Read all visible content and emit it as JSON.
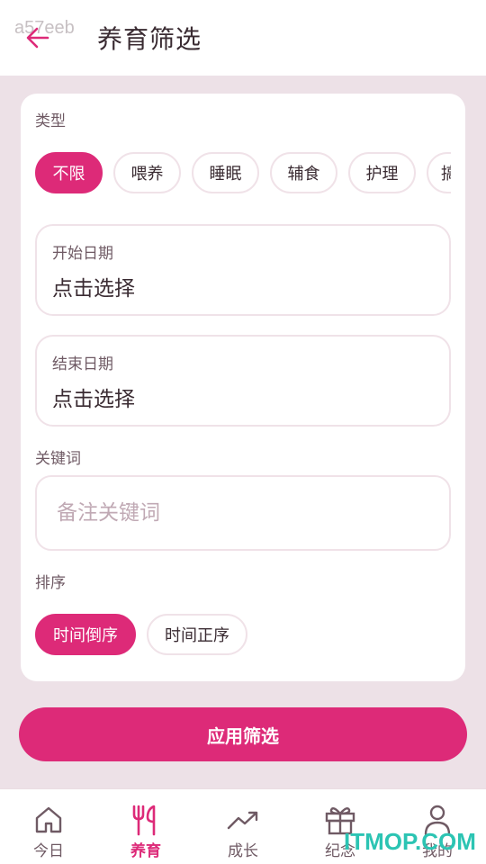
{
  "watermark_top": "a57eeb",
  "header": {
    "title": "养育筛选"
  },
  "type_section": {
    "label": "类型",
    "chips": [
      {
        "label": "不限",
        "active": true
      },
      {
        "label": "喂养",
        "active": false
      },
      {
        "label": "睡眠",
        "active": false
      },
      {
        "label": "辅食",
        "active": false
      },
      {
        "label": "护理",
        "active": false
      },
      {
        "label": "搞",
        "active": false
      }
    ]
  },
  "start_date": {
    "label": "开始日期",
    "value": "点击选择"
  },
  "end_date": {
    "label": "结束日期",
    "value": "点击选择"
  },
  "keyword": {
    "label": "关键词",
    "placeholder": "备注关键词"
  },
  "sort": {
    "label": "排序",
    "options": [
      {
        "label": "时间倒序",
        "active": true
      },
      {
        "label": "时间正序",
        "active": false
      }
    ]
  },
  "apply_button": "应用筛选",
  "nav": [
    {
      "label": "今日",
      "icon": "home-icon",
      "active": false
    },
    {
      "label": "养育",
      "icon": "fork-knife-icon",
      "active": true
    },
    {
      "label": "成长",
      "icon": "trend-up-icon",
      "active": false
    },
    {
      "label": "纪念",
      "icon": "gift-icon",
      "active": false
    },
    {
      "label": "我的",
      "icon": "user-icon",
      "active": false
    }
  ],
  "watermark_bottom": "ITMOP.COM",
  "colors": {
    "accent": "#dd2a78",
    "background": "#ede1e7",
    "chip_border": "#f0e2e8"
  }
}
